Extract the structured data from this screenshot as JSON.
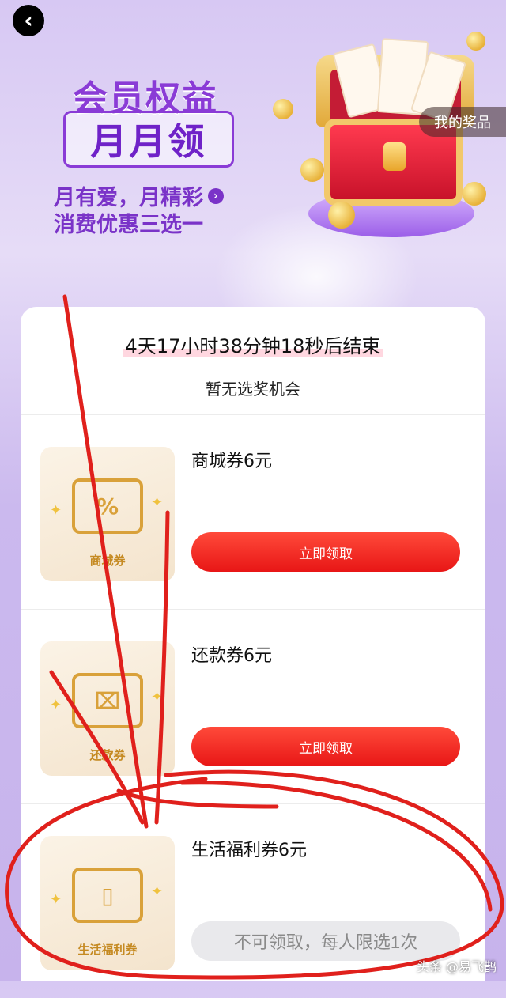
{
  "nav": {
    "back_icon": "chevron-left-icon",
    "back_glyph": "‹"
  },
  "banner": {
    "title": "会员权益",
    "subtitle": "月月领",
    "slogan1": "月有爱，月精彩",
    "slogan_arrow": "›",
    "slogan2": "消费优惠三选一",
    "my_prizes": "我的奖品"
  },
  "card": {
    "countdown": "4天17小时38分钟18秒后结束",
    "no_chance": "暂无选奖机会",
    "items": [
      {
        "name": "商城券6元",
        "image_label": "商城券",
        "image_icon": "%",
        "button": "立即领取",
        "state": "available"
      },
      {
        "name": "还款券6元",
        "image_label": "还款券",
        "image_icon": "⌧",
        "button": "立即领取",
        "state": "available"
      },
      {
        "name": "生活福利券6元",
        "image_label": "生活福利券",
        "image_icon": "▯",
        "button": "不可领取，每人限选1次",
        "state": "disabled"
      }
    ]
  },
  "watermark": "头条 @易飞鹊",
  "colors": {
    "accent_purple": "#7a33c8",
    "button_red": "#e81616",
    "annotation_red": "#e0201c"
  }
}
